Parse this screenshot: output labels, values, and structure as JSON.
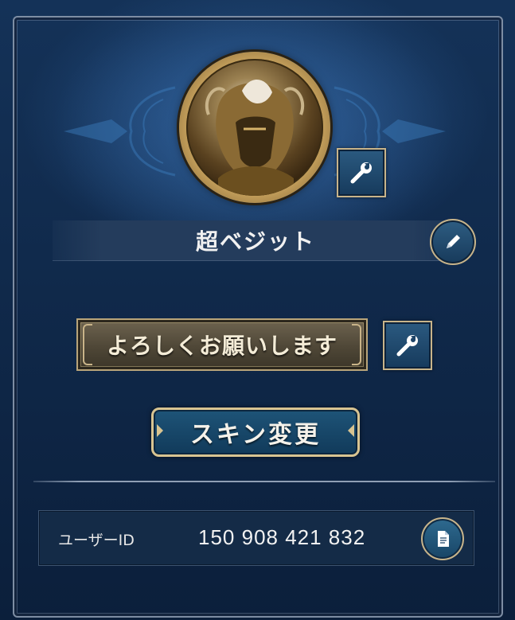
{
  "profile": {
    "player_name": "超ベジット",
    "avatar_icon": "armored-knight-portrait",
    "greeting": "よろしくお願いします",
    "skin_button_label": "スキン変更",
    "user_id_label": "ユーザーID",
    "user_id_value": "150 908 421 832"
  },
  "icons": {
    "avatar_edit": "wrench-icon",
    "name_edit": "pencil-icon",
    "greeting_edit": "wrench-icon",
    "copy_id": "document-copy-icon"
  },
  "colors": {
    "background": "#0e2746",
    "gold_border": "#c8b48a",
    "button_blue": "#1e5478"
  }
}
